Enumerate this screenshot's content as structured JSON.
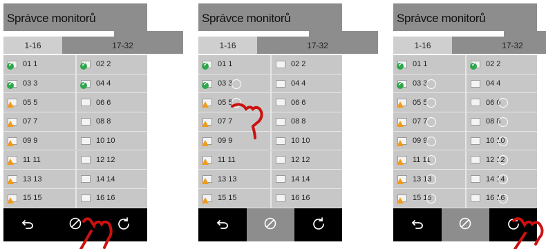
{
  "panels": [
    {
      "title": "Správce monitorů",
      "tabs": [
        "1-16",
        "17-32"
      ],
      "monitors": [
        {
          "label": "01 1",
          "status": "ok"
        },
        {
          "label": "02 2",
          "status": "ok"
        },
        {
          "label": "03 3",
          "status": "ok"
        },
        {
          "label": "04 4",
          "status": "ok"
        },
        {
          "label": "05 5",
          "status": "warning"
        },
        {
          "label": "06 6",
          "status": "none"
        },
        {
          "label": "07 7",
          "status": "warning"
        },
        {
          "label": "08 8",
          "status": "none"
        },
        {
          "label": "09 9",
          "status": "warning"
        },
        {
          "label": "10 10",
          "status": "none"
        },
        {
          "label": "11 11",
          "status": "warning"
        },
        {
          "label": "12 12",
          "status": "none"
        },
        {
          "label": "13 13",
          "status": "warning"
        },
        {
          "label": "14 14",
          "status": "none"
        },
        {
          "label": "15 15",
          "status": "warning"
        },
        {
          "label": "16 16",
          "status": "none"
        }
      ],
      "toolbar": [
        "undo-icon",
        "disable-icon",
        "refresh-icon"
      ],
      "active_button": null,
      "highlighted_rings": []
    },
    {
      "title": "Správce monitorů",
      "tabs": [
        "1-16",
        "17-32"
      ],
      "monitors": [
        {
          "label": "01 1",
          "status": "ok"
        },
        {
          "label": "02 2",
          "status": "none"
        },
        {
          "label": "03 3",
          "status": "ok"
        },
        {
          "label": "04 4",
          "status": "none"
        },
        {
          "label": "05 5",
          "status": "warning"
        },
        {
          "label": "06 6",
          "status": "none"
        },
        {
          "label": "07 7",
          "status": "warning"
        },
        {
          "label": "08 8",
          "status": "none"
        },
        {
          "label": "09 9",
          "status": "warning"
        },
        {
          "label": "10 10",
          "status": "none"
        },
        {
          "label": "11 11",
          "status": "warning"
        },
        {
          "label": "12 12",
          "status": "none"
        },
        {
          "label": "13 13",
          "status": "warning"
        },
        {
          "label": "14 14",
          "status": "none"
        },
        {
          "label": "15 15",
          "status": "warning"
        },
        {
          "label": "16 16",
          "status": "none"
        }
      ],
      "toolbar": [
        "undo-icon",
        "disable-icon",
        "refresh-icon"
      ],
      "active_button": 1,
      "highlighted_rings": [
        "03 3",
        "05 5"
      ]
    },
    {
      "title": "Správce monitorů",
      "tabs": [
        "1-16",
        "17-32"
      ],
      "monitors": [
        {
          "label": "01 1",
          "status": "ok"
        },
        {
          "label": "02 2",
          "status": "ok"
        },
        {
          "label": "03 3",
          "status": "ok"
        },
        {
          "label": "04 4",
          "status": "none"
        },
        {
          "label": "05 5",
          "status": "warning"
        },
        {
          "label": "06 6",
          "status": "none"
        },
        {
          "label": "07 7",
          "status": "warning"
        },
        {
          "label": "08 8",
          "status": "none"
        },
        {
          "label": "09 9",
          "status": "warning"
        },
        {
          "label": "10 10",
          "status": "none"
        },
        {
          "label": "11 11",
          "status": "warning"
        },
        {
          "label": "12 12",
          "status": "none"
        },
        {
          "label": "13 13",
          "status": "warning"
        },
        {
          "label": "14 14",
          "status": "none"
        },
        {
          "label": "15 15",
          "status": "warning"
        },
        {
          "label": "16 16",
          "status": "none"
        }
      ],
      "toolbar": [
        "undo-icon",
        "disable-icon",
        "refresh-icon"
      ],
      "active_button": 1,
      "highlighted_rings": [
        "03 3",
        "05 5",
        "06 6",
        "07 7",
        "08 8",
        "09 9",
        "10 10",
        "11 11",
        "12 12",
        "13 13",
        "14 14",
        "15 15",
        "16 16"
      ]
    }
  ],
  "colors": {
    "header_gray": "#8d8d8d",
    "grid_gray": "#c7c7c7",
    "ok_green": "#2ca84b",
    "warn_orange": "#f29a1a",
    "toolbar_black": "#000000",
    "hand_red": "#cc1111"
  }
}
